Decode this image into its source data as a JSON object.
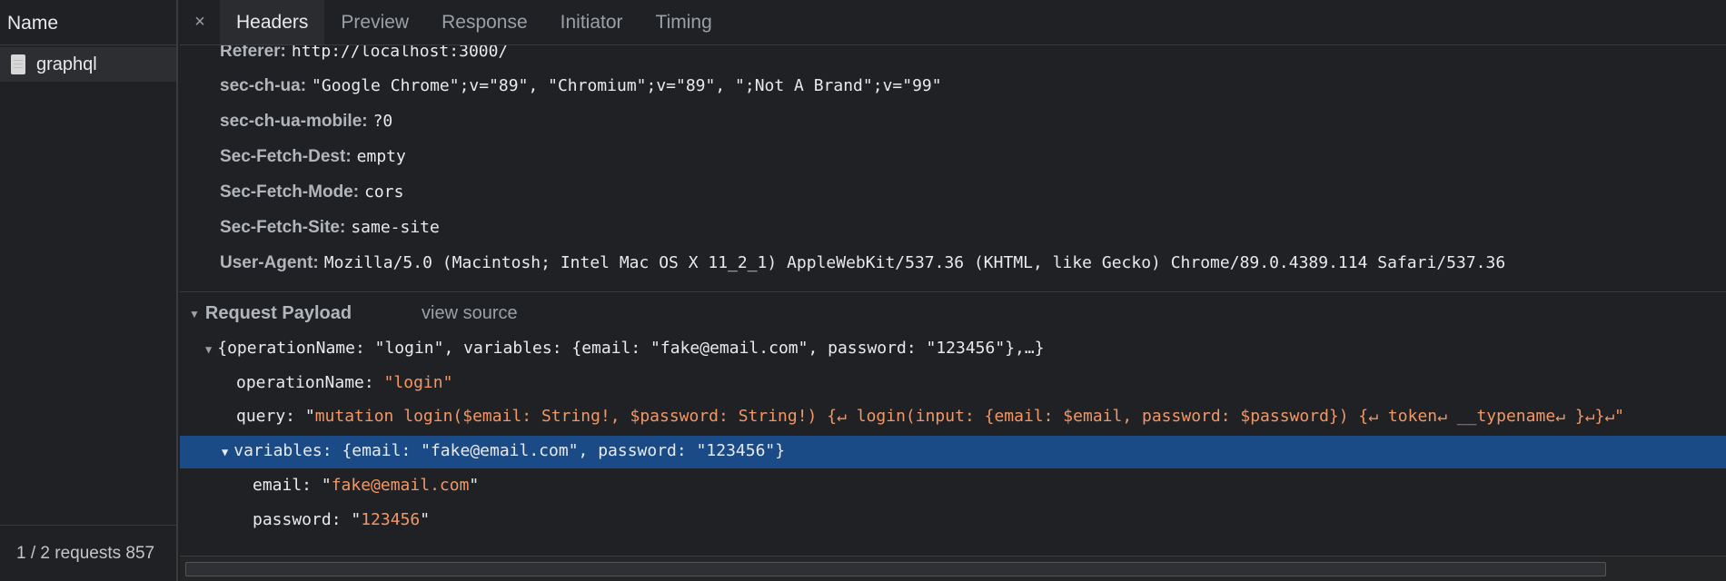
{
  "left_panel": {
    "header": "Name",
    "requests": [
      {
        "name": "graphql"
      }
    ],
    "footer": "1 / 2 requests 857"
  },
  "tabs": {
    "close": "×",
    "items": [
      {
        "label": "Headers",
        "active": true
      },
      {
        "label": "Preview",
        "active": false
      },
      {
        "label": "Response",
        "active": false
      },
      {
        "label": "Initiator",
        "active": false
      },
      {
        "label": "Timing",
        "active": false
      }
    ]
  },
  "request_headers": [
    {
      "key": "Referer:",
      "value": "http://localhost:3000/"
    },
    {
      "key": "sec-ch-ua:",
      "value": "\"Google Chrome\";v=\"89\", \"Chromium\";v=\"89\", \";Not A Brand\";v=\"99\""
    },
    {
      "key": "sec-ch-ua-mobile:",
      "value": "?0"
    },
    {
      "key": "Sec-Fetch-Dest:",
      "value": "empty"
    },
    {
      "key": "Sec-Fetch-Mode:",
      "value": "cors"
    },
    {
      "key": "Sec-Fetch-Site:",
      "value": "same-site"
    },
    {
      "key": "User-Agent:",
      "value": "Mozilla/5.0 (Macintosh; Intel Mac OS X 11_2_1) AppleWebKit/537.36 (KHTML, like Gecko) Chrome/89.0.4389.114 Safari/537.36"
    }
  ],
  "payload": {
    "title": "Request Payload",
    "view_source": "view source",
    "summary": "{operationName: \"login\", variables: {email: \"fake@email.com\", password: \"123456\"},…}",
    "operation_key": "operationName: ",
    "operation_value": "\"login\"",
    "query_key": "query: ",
    "query_open": "\"",
    "query_value": "mutation login($email: String!, $password: String!) {↵  login(input: {email: $email, password: $password}) {↵    token↵    __typename↵  }↵}↵\"",
    "variables_summary": "variables: {email: \"fake@email.com\", password: \"123456\"}",
    "email_key": "email: ",
    "email_open": "\"",
    "email_value": "fake@email.com",
    "email_close": "\"",
    "password_key": "password: ",
    "password_open": "\"",
    "password_value": "123456",
    "password_close": "\""
  },
  "colors": {
    "selection": "#1a4b87",
    "string": "#f29766",
    "background": "#202124"
  }
}
